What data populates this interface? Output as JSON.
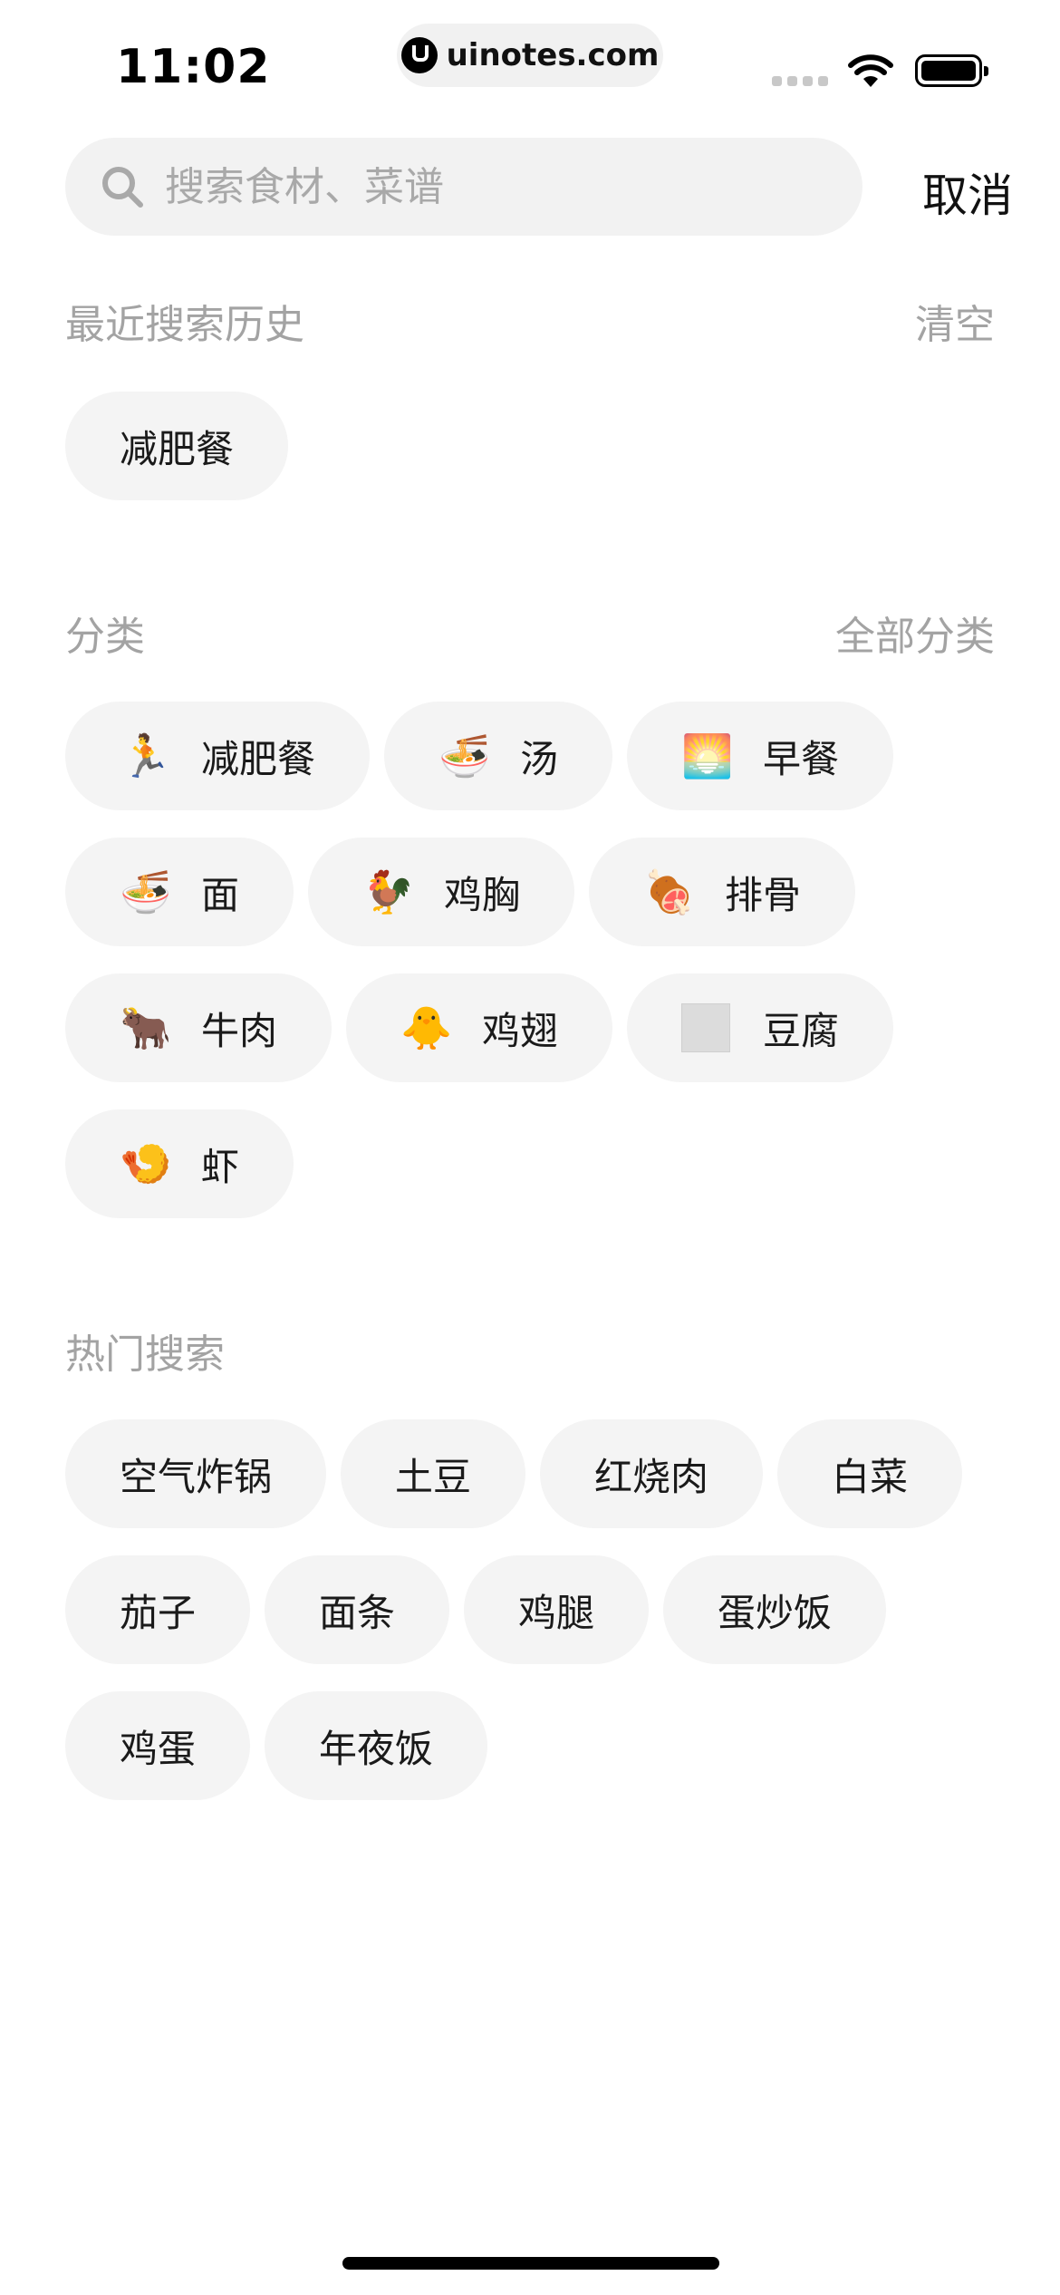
{
  "status_bar": {
    "time": "11:02",
    "url": "uinotes.com"
  },
  "search": {
    "placeholder": "搜索食材、菜谱",
    "value": "",
    "cancel_label": "取消"
  },
  "history": {
    "title": "最近搜索历史",
    "action": "清空",
    "items": [
      "减肥餐"
    ]
  },
  "categories": {
    "title": "分类",
    "action": "全部分类",
    "items": [
      {
        "emoji": "🏃",
        "label": "减肥餐"
      },
      {
        "emoji": "🍜",
        "label": "汤"
      },
      {
        "emoji": "🌅",
        "label": "早餐"
      },
      {
        "emoji": "🍜",
        "label": "面"
      },
      {
        "emoji": "🐓",
        "label": "鸡胸"
      },
      {
        "emoji": "🍖",
        "label": "排骨"
      },
      {
        "emoji": "🐂",
        "label": "牛肉"
      },
      {
        "emoji": "🐥",
        "label": "鸡翅"
      },
      {
        "emoji": "",
        "label": "豆腐"
      },
      {
        "emoji": "🍤",
        "label": "虾"
      }
    ]
  },
  "hot": {
    "title": "热门搜索",
    "items": [
      "空气炸锅",
      "土豆",
      "红烧肉",
      "白菜",
      "茄子",
      "面条",
      "鸡腿",
      "蛋炒饭",
      "鸡蛋",
      "年夜饭"
    ]
  }
}
